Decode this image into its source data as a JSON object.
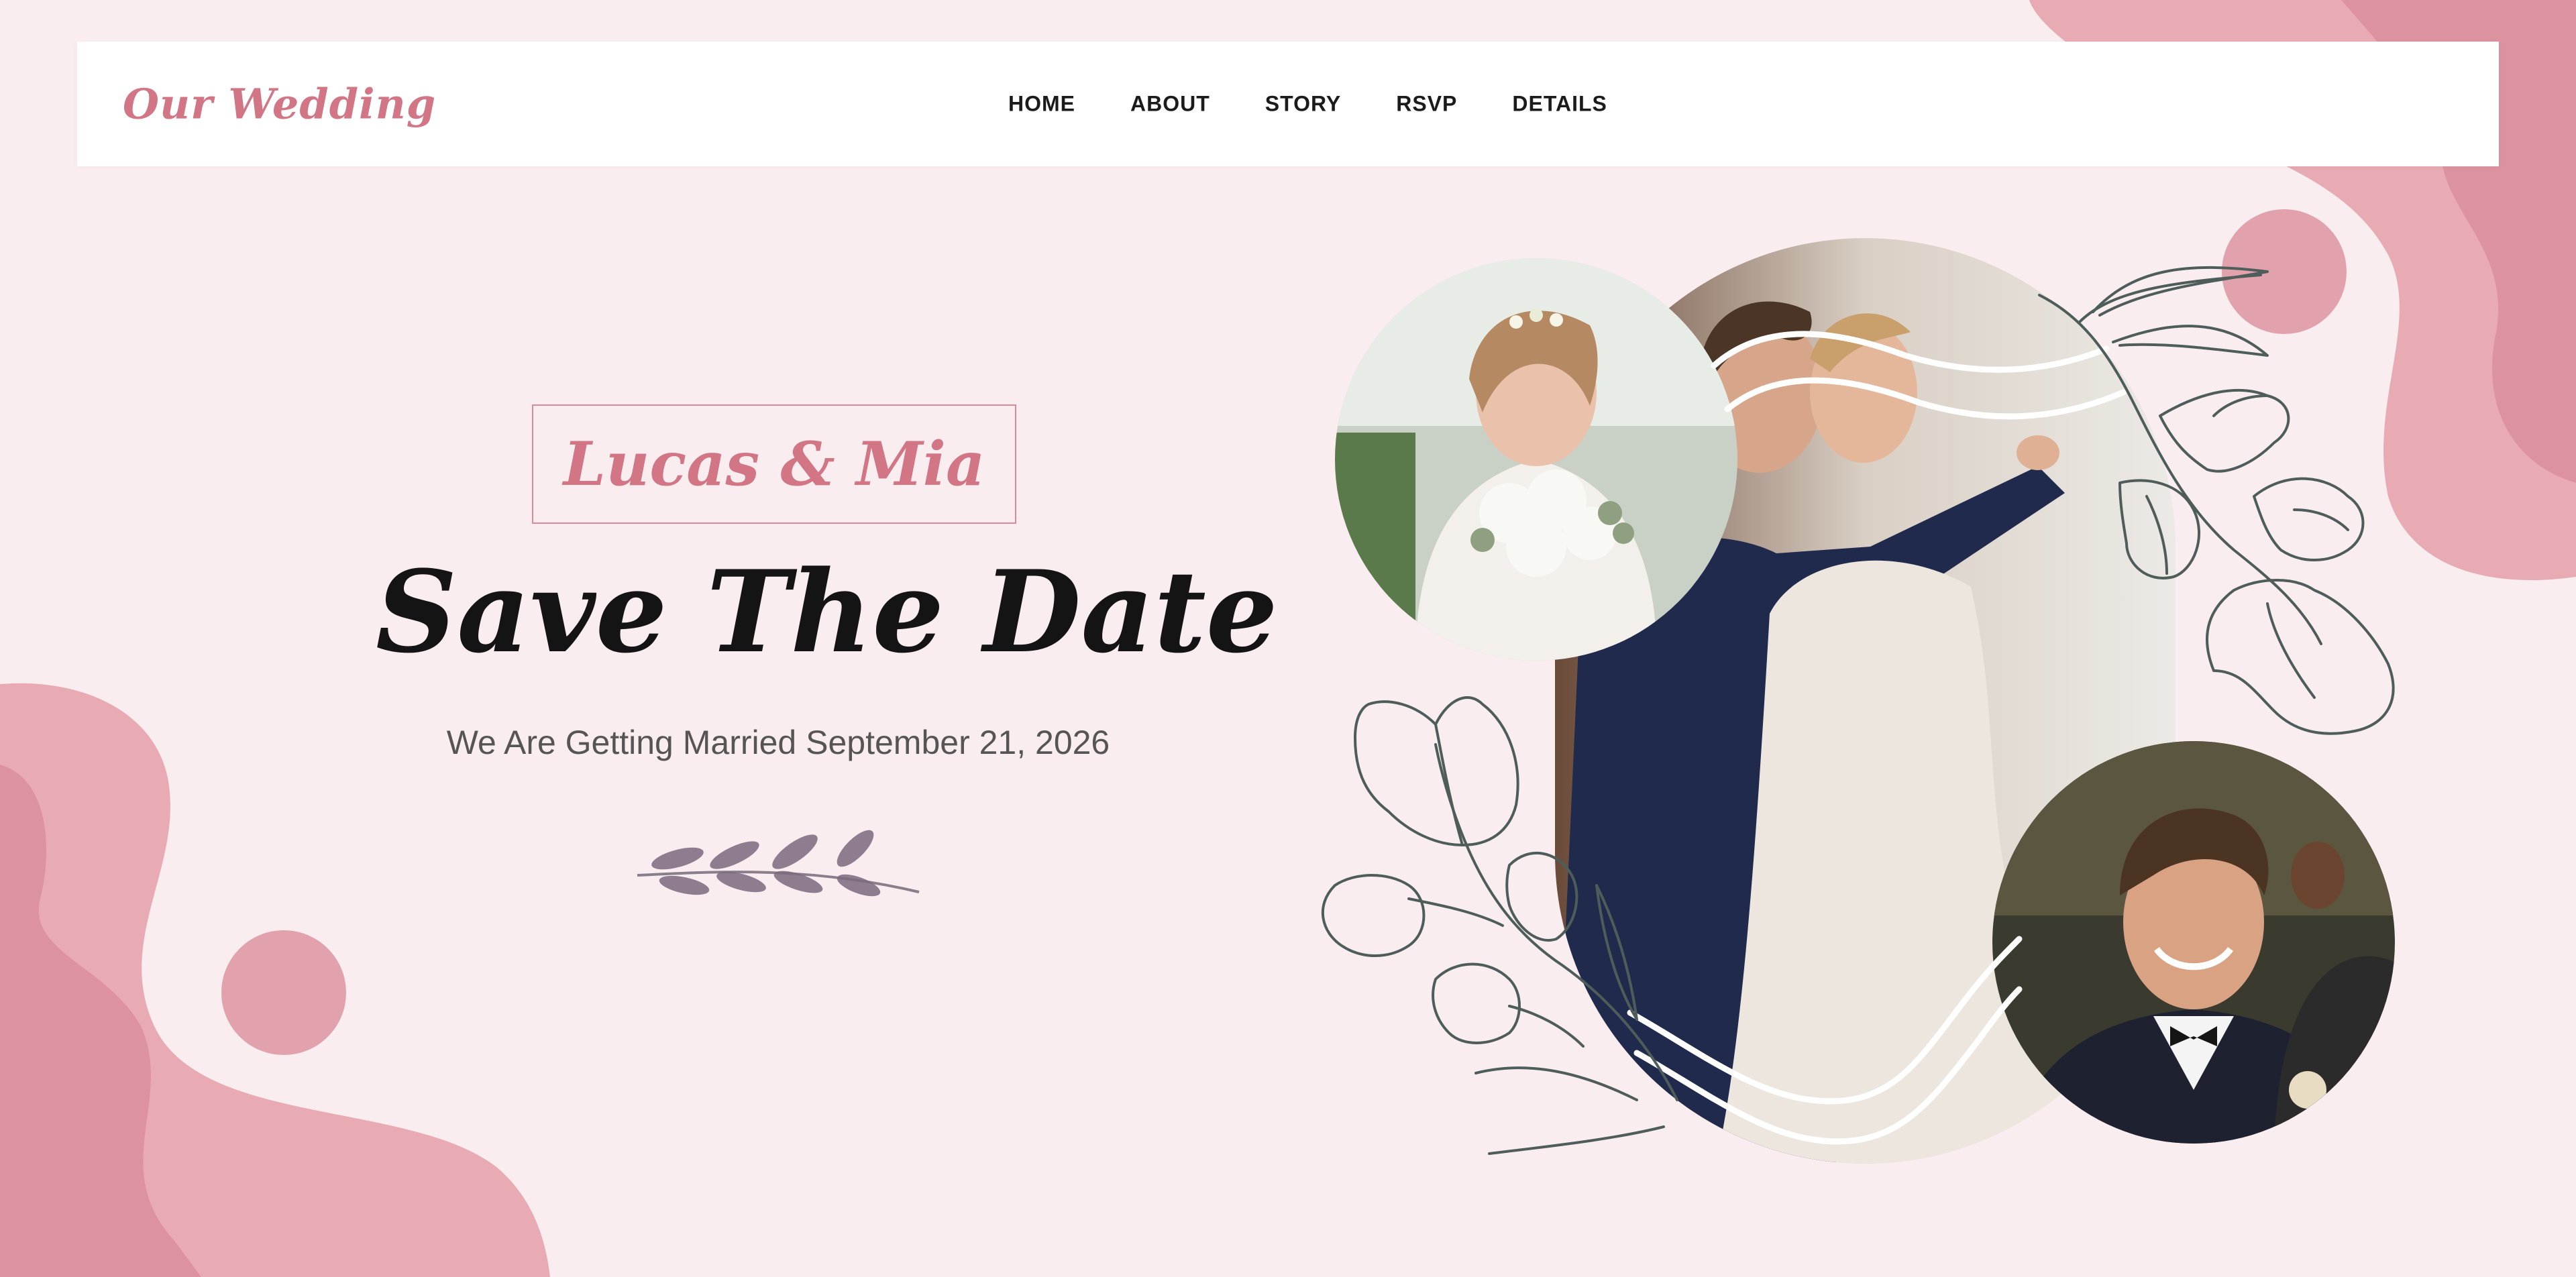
{
  "navbar": {
    "logo": "Our Wedding",
    "menu": [
      "HOME",
      "ABOUT",
      "STORY",
      "RSVP",
      "DETAILS"
    ]
  },
  "hero": {
    "couple": "Lucas & Mia",
    "headline": "Save The Date",
    "subtitle": "We Are Getting Married September 21, 2026"
  },
  "colors": {
    "background": "#f9edf0",
    "accent": "#d27686",
    "blob_light": "#e8aab3",
    "blob_dark": "#dd939f",
    "line_art": "#4e5d5a"
  },
  "icons": [
    "leaf-sprig-icon",
    "floral-line-art"
  ]
}
